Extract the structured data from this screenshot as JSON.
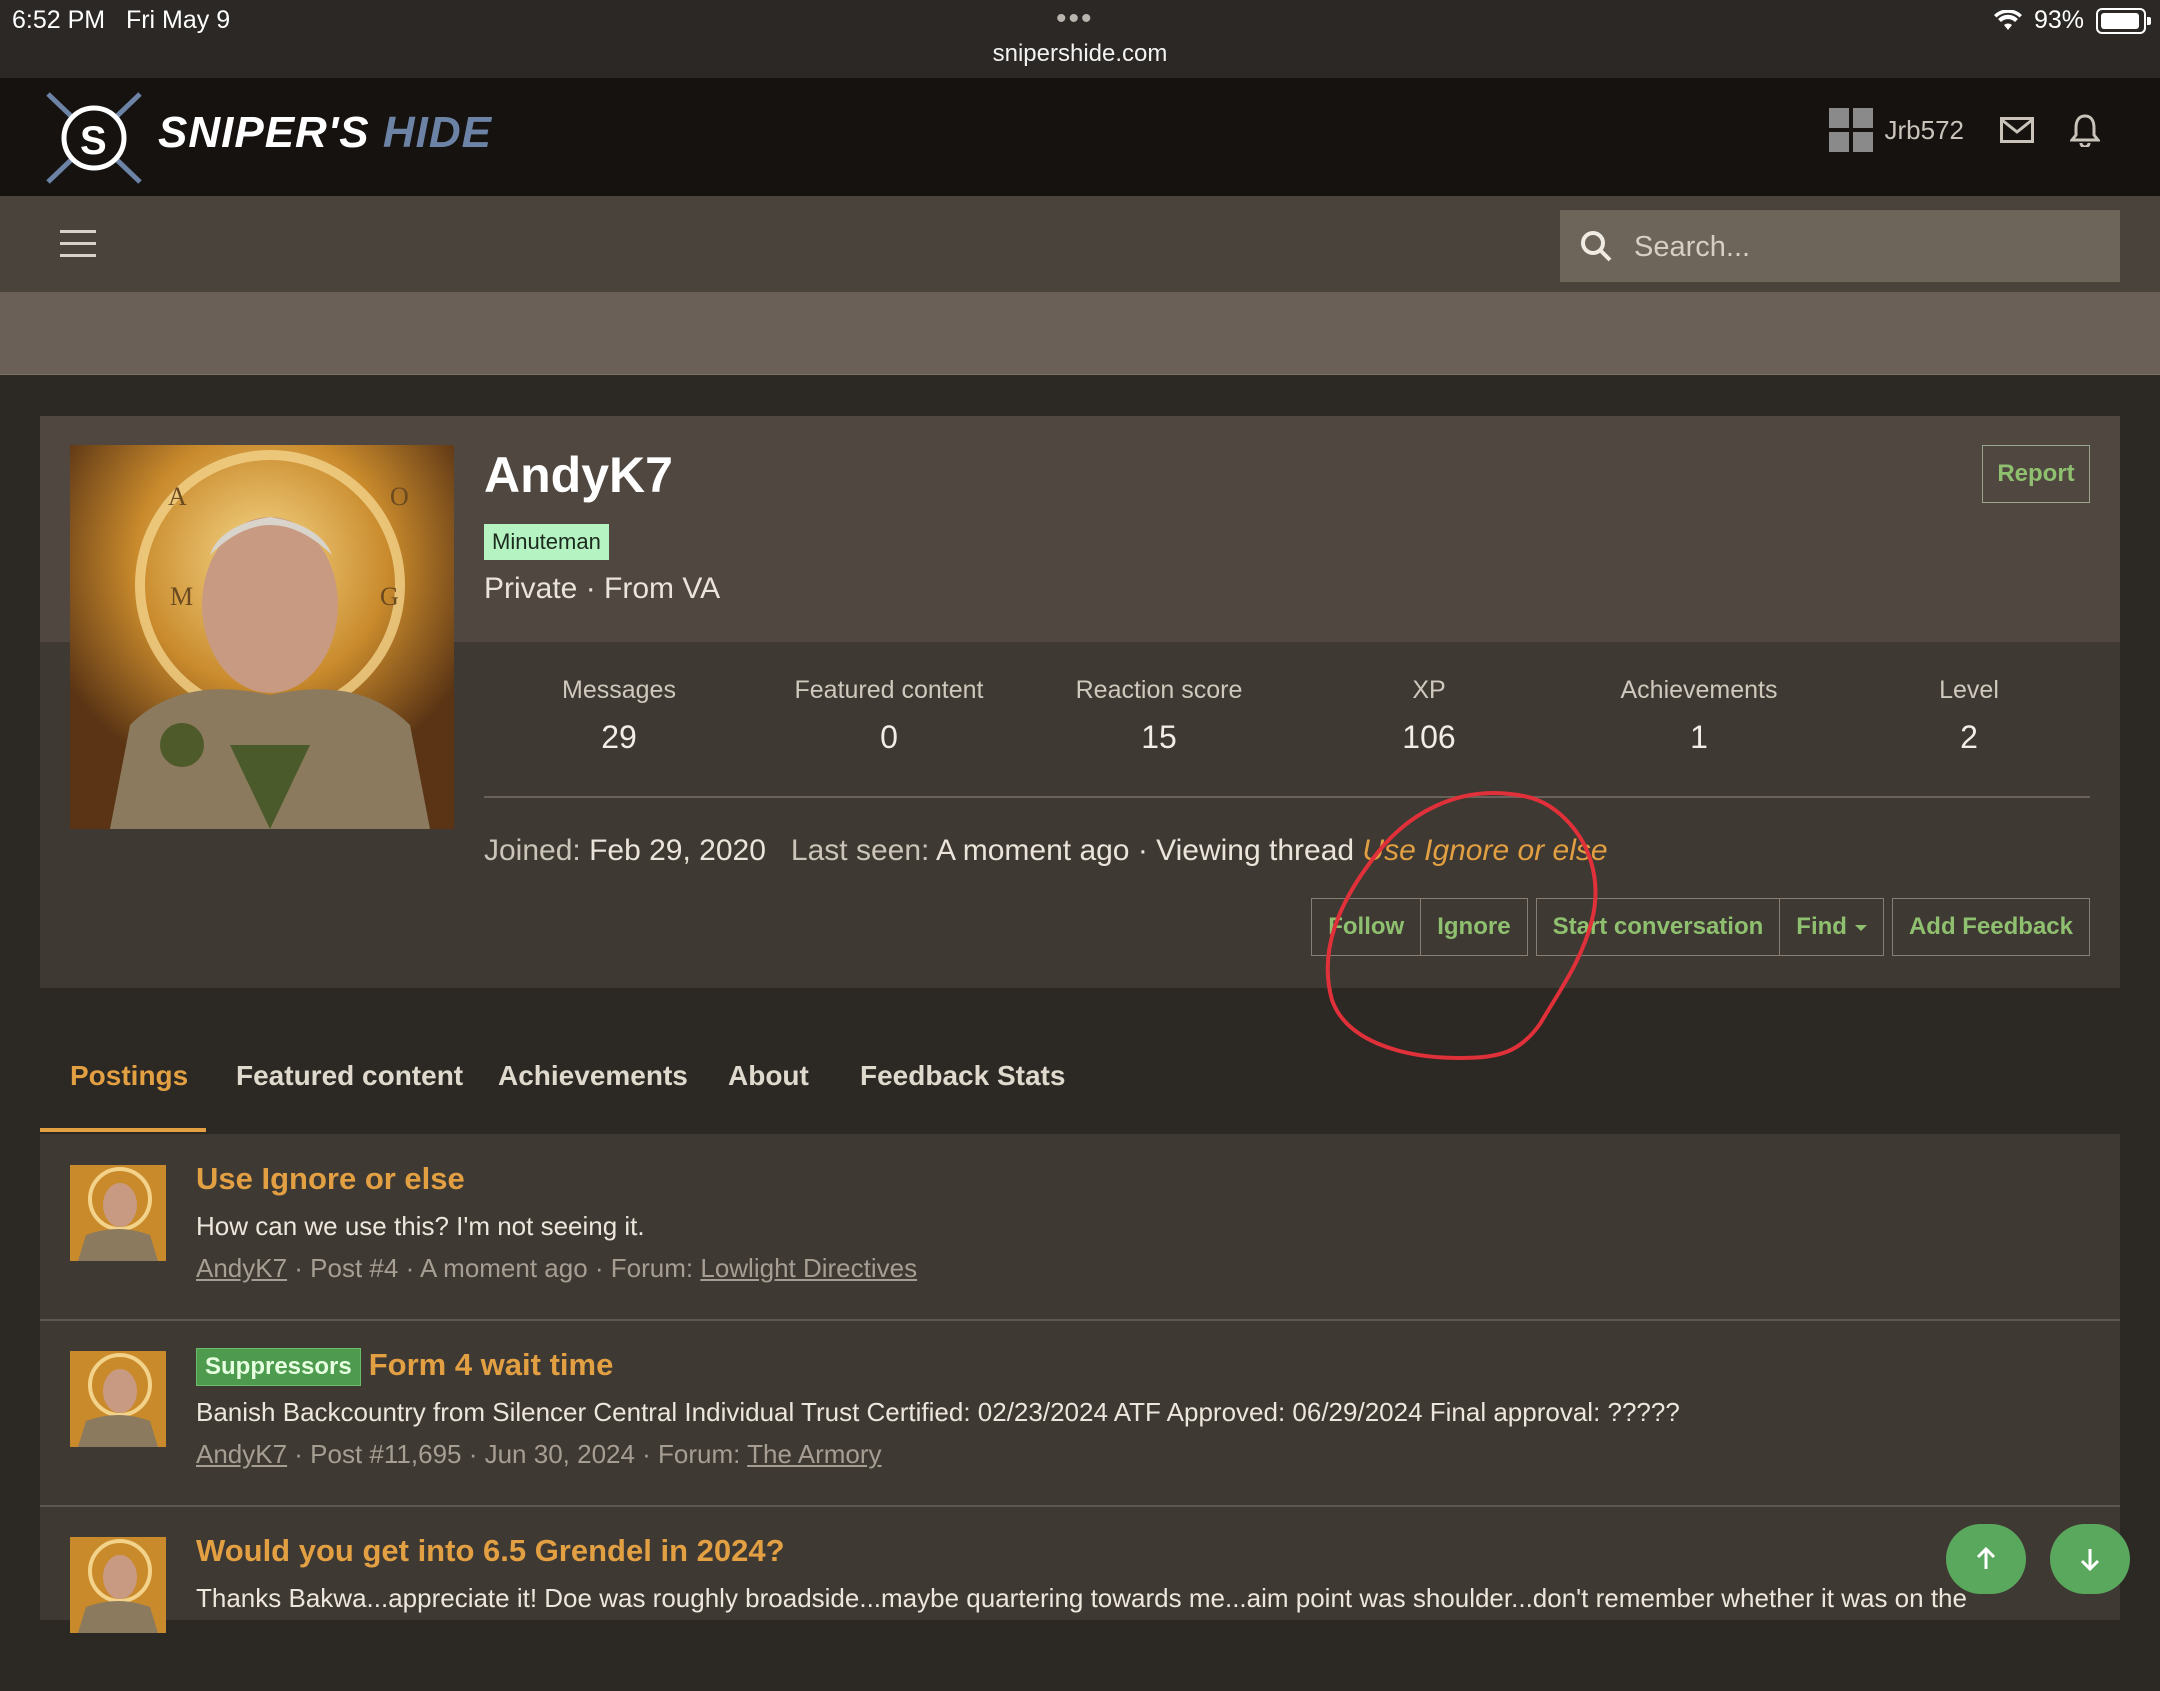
{
  "status_bar": {
    "time": "6:52 PM",
    "date": "Fri May 9",
    "dots": "•••",
    "url": "snipershide.com",
    "battery": "93%"
  },
  "site": {
    "logo_part1": "SNIPER'S",
    "logo_part2": "HIDE",
    "username": "Jrb572"
  },
  "search": {
    "placeholder": "Search..."
  },
  "profile": {
    "username": "AndyK7",
    "badge": "Minuteman",
    "sub_info": "Private · From VA",
    "report_label": "Report",
    "stats": [
      {
        "label": "Messages",
        "value": "29"
      },
      {
        "label": "Featured content",
        "value": "0"
      },
      {
        "label": "Reaction score",
        "value": "15"
      },
      {
        "label": "XP",
        "value": "106"
      },
      {
        "label": "Achievements",
        "value": "1"
      },
      {
        "label": "Level",
        "value": "2"
      }
    ],
    "joined_label": "Joined:",
    "joined_value": "Feb 29, 2020",
    "last_seen_label": "Last seen:",
    "last_seen_value": "A moment ago · Viewing thread",
    "viewing_thread": "Use Ignore or else",
    "actions": {
      "follow": "Follow",
      "ignore": "Ignore",
      "start_conversation": "Start conversation",
      "find": "Find",
      "add_feedback": "Add Feedback"
    }
  },
  "tabs": [
    "Postings",
    "Featured content",
    "Achievements",
    "About",
    "Feedback Stats"
  ],
  "posts": [
    {
      "prefix": "",
      "title": "Use Ignore or else",
      "snippet": "How can we use this? I'm not seeing it.",
      "author": "AndyK7",
      "meta": " · Post #4 · A moment ago · Forum: ",
      "forum": "Lowlight Directives"
    },
    {
      "prefix": "Suppressors",
      "title": "Form 4 wait time",
      "snippet": "Banish Backcountry from Silencer Central Individual Trust Certified: 02/23/2024 ATF Approved: 06/29/2024 Final approval: ?????",
      "author": "AndyK7",
      "meta": " · Post #11,695 · Jun 30, 2024 · Forum: ",
      "forum": "The Armory"
    },
    {
      "prefix": "",
      "title": "Would you get into 6.5 Grendel in 2024?",
      "snippet": "Thanks Bakwa...appreciate it! Doe was roughly broadside...maybe quartering towards me...aim point was shoulder...don't remember whether it was on the",
      "author": "",
      "meta": "",
      "forum": ""
    }
  ],
  "colors": {
    "accent_orange": "#e3a043",
    "button_green": "#8fc06f",
    "annotation_red": "#e0303a"
  }
}
